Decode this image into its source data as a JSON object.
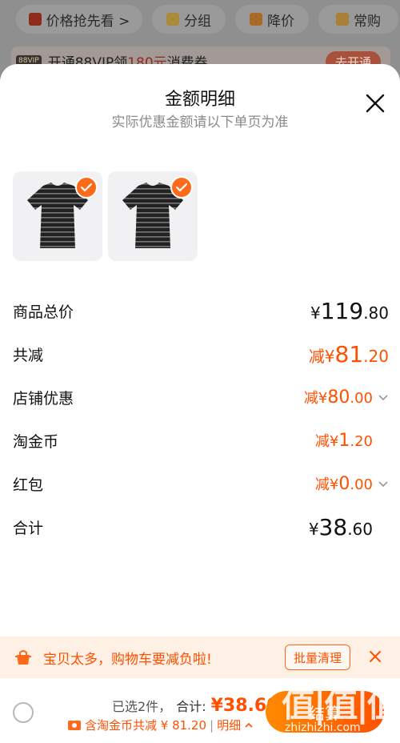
{
  "background": {
    "chips": [
      {
        "label": "价格抢先看 >"
      },
      {
        "label": "分组"
      },
      {
        "label": "降价"
      },
      {
        "label": "常购"
      }
    ],
    "vip_banner": {
      "tag": "88VIP",
      "prefix": "开通88VIP领",
      "amount": "180元",
      "suffix": "消费券",
      "button": "去开通"
    }
  },
  "sheet": {
    "title": "金额明细",
    "subtitle": "实际优惠金额请以下单页为准",
    "products": [
      {
        "name": "striped-tshirt",
        "selected": true
      },
      {
        "name": "striped-tshirt",
        "selected": true
      }
    ],
    "rows": {
      "total": {
        "label": "商品总价",
        "currency": "¥",
        "int": "119",
        "dec": ".80"
      },
      "discount": {
        "label": "共减",
        "prefix": "减¥",
        "int": "81",
        "dec": ".20"
      },
      "shop": {
        "label": "店铺优惠",
        "prefix": "减¥",
        "int": "80",
        "dec": ".00"
      },
      "coin": {
        "label": "淘金币",
        "prefix": "减¥",
        "int": "1",
        "dec": ".20"
      },
      "redpacket": {
        "label": "红包",
        "prefix": "减¥",
        "int": "0",
        "dec": ".00"
      },
      "sum": {
        "label": "合计",
        "currency": "¥",
        "int": "38",
        "dec": ".60"
      }
    }
  },
  "notice": {
    "text": "宝贝太多，购物车要减负啦!",
    "button": "批量清理"
  },
  "bottom_bar": {
    "selected": "已选2件，",
    "total_label": "合计:",
    "total_price": "¥38.60",
    "coin_text": "含淘金币共减 ¥ 81.20",
    "detail": "明细",
    "checkout": "结算",
    "watermark": "值|值|值",
    "watermark_url": "zhizhizhi.com"
  },
  "colors": {
    "accent": "#ff5000",
    "check": "#ff6a1a"
  }
}
